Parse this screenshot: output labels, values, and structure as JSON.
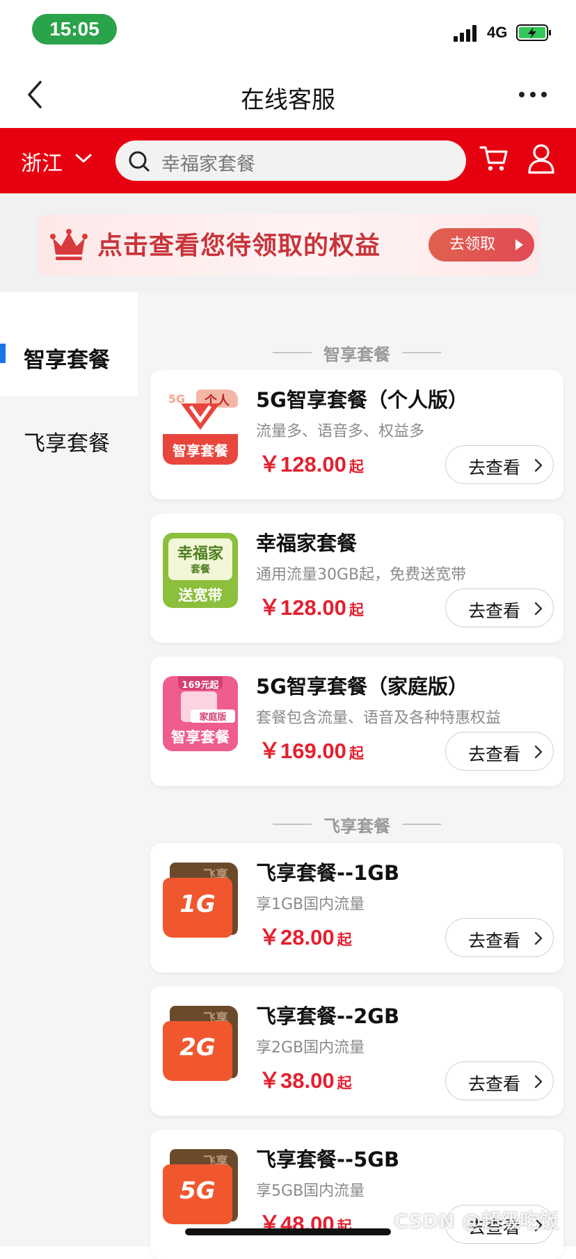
{
  "status_bar": {
    "time": "15:05",
    "network": "4G"
  },
  "nav": {
    "title": "在线客服"
  },
  "header": {
    "region": "浙江",
    "search_placeholder": "幸福家套餐"
  },
  "banner": {
    "text": "点击查看您待领取的权益",
    "button": "去领取"
  },
  "sidebar": {
    "items": [
      {
        "label": "智享套餐"
      },
      {
        "label": "飞享套餐"
      }
    ]
  },
  "sections": [
    {
      "title": "智享套餐",
      "cards": [
        {
          "title": "5G智享套餐（个人版）",
          "desc": "流量多、语音多、权益多",
          "price": "￥128.00",
          "suffix": "起",
          "button": "去查看",
          "thumb": {
            "tag": "个人",
            "corner": "5G",
            "label": "智享套餐"
          }
        },
        {
          "title": "幸福家套餐",
          "desc": "通用流量30GB起，免费送宽带",
          "price": "￥128.00",
          "suffix": "起",
          "button": "去查看",
          "thumb": {
            "line1": "幸福家",
            "line2": "套餐",
            "label": "送宽带"
          }
        },
        {
          "title": "5G智享套餐（家庭版）",
          "desc": "套餐包含流量、语音及各种特惠权益",
          "price": "￥169.00",
          "suffix": "起",
          "button": "去查看",
          "thumb": {
            "tag": "169元起",
            "sub": "家庭版",
            "label": "智享套餐"
          }
        }
      ]
    },
    {
      "title": "飞享套餐",
      "cards": [
        {
          "title": "飞享套餐--1GB",
          "desc": "享1GB国内流量",
          "price": "￥28.00",
          "suffix": "起",
          "button": "去查看",
          "thumb": {
            "tab": "飞享",
            "label": "1G"
          }
        },
        {
          "title": "飞享套餐--2GB",
          "desc": "享2GB国内流量",
          "price": "￥38.00",
          "suffix": "起",
          "button": "去查看",
          "thumb": {
            "tab": "飞享",
            "label": "2G"
          }
        },
        {
          "title": "飞享套餐--5GB",
          "desc": "享5GB国内流量",
          "price": "￥48.00",
          "suffix": "起",
          "button": "去查看",
          "thumb": {
            "tab": "飞享",
            "label": "5G"
          }
        }
      ]
    }
  ],
  "watermark": "CSDN @超级吃饭",
  "colors": {
    "brand_red": "#e7000f",
    "price_red": "#e4202e",
    "status_green": "#2aa34a",
    "active_indicator": "#1a73e8"
  }
}
